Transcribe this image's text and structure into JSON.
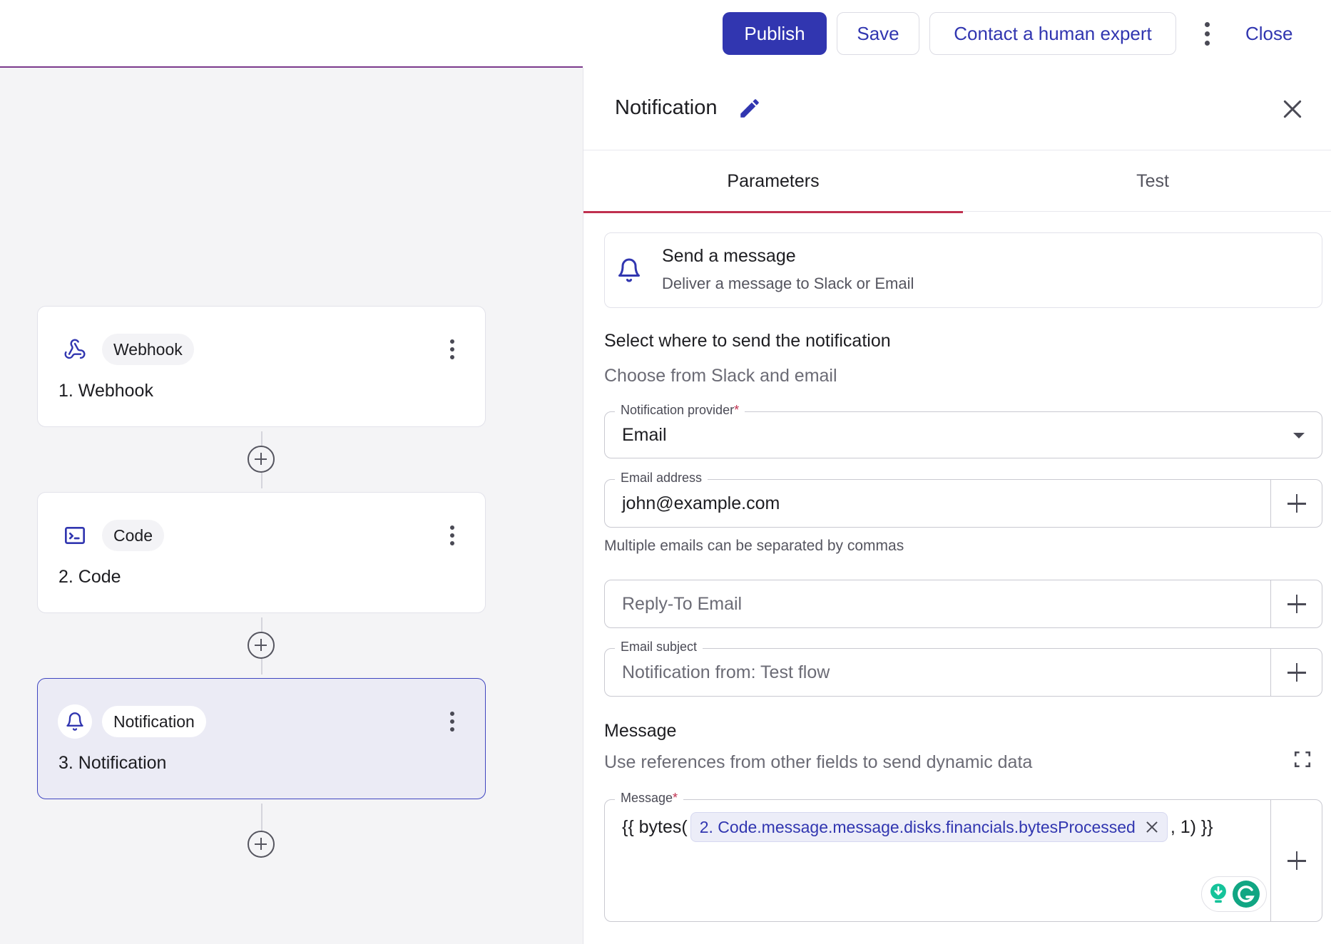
{
  "topbar": {
    "publish_label": "Publish",
    "save_label": "Save",
    "contact_label": "Contact a human expert",
    "close_label": "Close"
  },
  "flow": {
    "nodes": [
      {
        "chip": "Webhook",
        "title": "1. Webhook",
        "icon": "webhook-icon"
      },
      {
        "chip": "Code",
        "title": "2. Code",
        "icon": "terminal-icon"
      },
      {
        "chip": "Notification",
        "title": "3. Notification",
        "icon": "bell-icon",
        "active": true
      }
    ]
  },
  "panel": {
    "title": "Notification",
    "tabs": [
      "Parameters",
      "Test"
    ],
    "action": {
      "title": "Send a message",
      "subtitle": "Deliver a message to Slack or Email"
    },
    "destination": {
      "heading": "Select where to send the notification",
      "subheading": "Choose from Slack and email"
    },
    "provider": {
      "label": "Notification provider",
      "value": "Email"
    },
    "email": {
      "label": "Email address",
      "value": "john@example.com",
      "helper": "Multiple emails can be separated by commas"
    },
    "reply_to": {
      "placeholder": "Reply-To Email"
    },
    "subject": {
      "label": "Email subject",
      "placeholder": "Notification from: Test flow"
    },
    "message_section": {
      "heading": "Message",
      "subheading": "Use references from other fields to send dynamic data"
    },
    "message": {
      "label": "Message",
      "prefix": "{{ bytes(",
      "reference": "2. Code.message.message.disks.financials.bytesProcessed",
      "suffix": ", 1) }}"
    }
  },
  "colors": {
    "primary": "#3136b0",
    "required": "#c0304f",
    "active_node_bg": "#ebebf5"
  }
}
